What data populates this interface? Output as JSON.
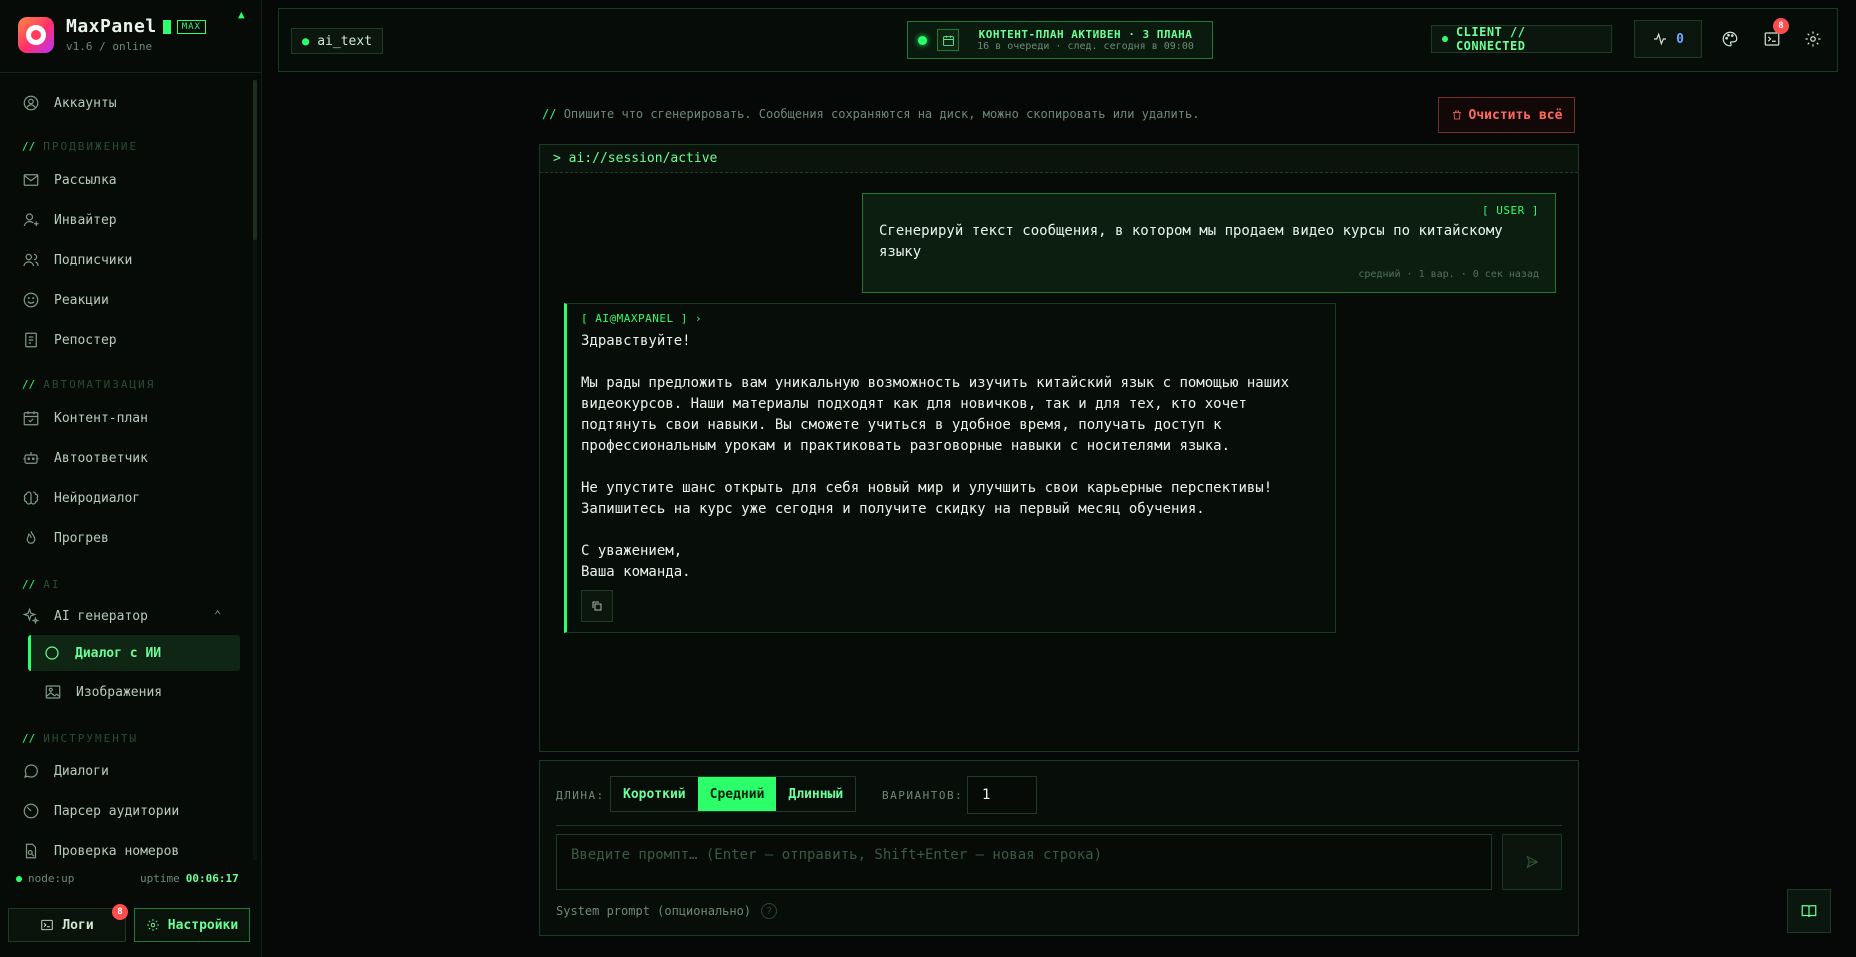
{
  "brand": {
    "name": "MaxPanel",
    "badge": "MAX",
    "version": "v1.6 / online"
  },
  "sidebar": {
    "items": [
      {
        "label": "Аккаунты",
        "icon": "user-circle-icon"
      },
      {
        "label": "Рассылка",
        "icon": "mail-icon"
      },
      {
        "label": "Инвайтер",
        "icon": "user-plus-icon"
      },
      {
        "label": "Подписчики",
        "icon": "users-icon"
      },
      {
        "label": "Реакции",
        "icon": "smile-icon"
      },
      {
        "label": "Репостер",
        "icon": "repost-icon"
      },
      {
        "label": "Контент-план",
        "icon": "calendar-icon"
      },
      {
        "label": "Автоответчик",
        "icon": "bot-icon"
      },
      {
        "label": "Нейродиалог",
        "icon": "brain-icon"
      },
      {
        "label": "Прогрев",
        "icon": "flame-icon"
      },
      {
        "label": "AI генератор",
        "icon": "sparkles-icon"
      },
      {
        "label": "Диалог с ИИ",
        "icon": "chat-bubble-icon"
      },
      {
        "label": "Изображения",
        "icon": "image-icon"
      },
      {
        "label": "Диалоги",
        "icon": "message-circle-icon"
      },
      {
        "label": "Парсер аудитории",
        "icon": "gauge-icon"
      },
      {
        "label": "Проверка номеров",
        "icon": "file-search-icon"
      }
    ],
    "sections": [
      "ПРОДВИЖЕНИЕ",
      "АВТОМАТИЗАЦИЯ",
      "AI",
      "ИНСТРУМЕНТЫ"
    ],
    "section_prefix": "//",
    "node_status": "node:up",
    "uptime_label": "uptime",
    "uptime_value": "00:06:17",
    "logs_label": "Логи",
    "logs_badge": "8",
    "settings_label": "Настройки"
  },
  "topbar": {
    "route": "ai_text",
    "plan_title": "КОНТЕНТ-ПЛАН АКТИВЕН · 3 ПЛАНА",
    "plan_sub": "16 в очереди · след. сегодня в 09:00",
    "client_status": "CLIENT // CONNECTED",
    "pulse_count": "0",
    "terminal_badge": "8"
  },
  "main": {
    "hint_prefix": "//",
    "hint": "Опишите что сгенерировать. Сообщения сохраняются на диск, можно скопировать или удалить.",
    "clear_label": "Очистить всё",
    "session_title": "> ai://session/active",
    "user_tag": "[ USER ]",
    "user_message": "Сгенерируй текст сообщения, в котором мы продаем видео курсы по китайскому языку",
    "user_meta": "средний · 1 вар. · 0 сек назад",
    "ai_tag": "[ AI@MAXPANEL ] ›",
    "ai_message": "Здравствуйте!\n\nМы рады предложить вам уникальную возможность изучить китайский язык с помощью наших видеокурсов. Наши материалы подходят как для новичков, так и для тех, кто хочет подтянуть свои навыки. Вы сможете учиться в удобное время, получать доступ к профессиональным урокам и практиковать разговорные навыки с носителями языка.\n\nНе упустите шанс открыть для себя новый мир и улучшить свои карьерные перспективы! Запишитесь на курс уже сегодня и получите скидку на первый месяц обучения.\n\nС уважением,\nВаша команда."
  },
  "composer": {
    "length_label": "ДЛИНА:",
    "lengths": [
      "Короткий",
      "Средний",
      "Длинный"
    ],
    "selected_length": "Средний",
    "variants_label": "ВАРИАНТОВ:",
    "variants_value": "1",
    "prompt_placeholder": "Введите промпт… (Enter — отправить, Shift+Enter — новая строка)",
    "system_prompt_label": "System prompt (опционально)",
    "help_glyph": "?"
  },
  "colors": {
    "accent": "#2bff6a",
    "background": "#050806",
    "danger": "#ff6b5c"
  }
}
